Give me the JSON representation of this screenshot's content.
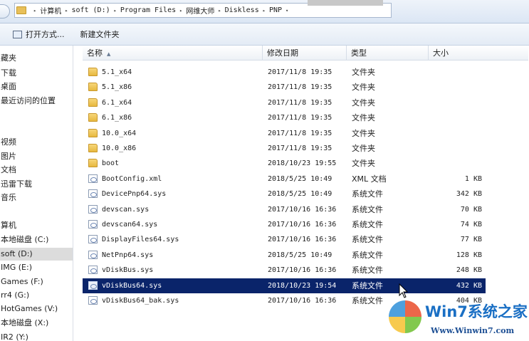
{
  "address": {
    "crumbs": [
      "计算机",
      "soft (D:)",
      "Program Files",
      "网维大师",
      "Diskless",
      "PNP"
    ]
  },
  "toolbar": {
    "open_with": "打开方式...",
    "new_folder": "新建文件夹"
  },
  "nav": {
    "items": [
      "藏夹",
      "下载",
      "桌面",
      "最近访问的位置",
      "视频",
      "图片",
      "文档",
      "迅雷下载",
      "音乐",
      "算机",
      "本地磁盘 (C:)",
      "soft (D:)",
      "IMG (E:)",
      "Games (F:)",
      "rr4 (G:)",
      "HotGames (V:)",
      "本地磁盘 (X:)",
      "IR2 (Y:)"
    ],
    "selected": "soft (D:)"
  },
  "columns": {
    "name": "名称",
    "date": "修改日期",
    "type": "类型",
    "size": "大小"
  },
  "files": [
    {
      "name": "5.1_x64",
      "date": "2017/11/8 19:35",
      "type": "文件夹",
      "size": "",
      "kind": "folder"
    },
    {
      "name": "5.1_x86",
      "date": "2017/11/8 19:35",
      "type": "文件夹",
      "size": "",
      "kind": "folder"
    },
    {
      "name": "6.1_x64",
      "date": "2017/11/8 19:35",
      "type": "文件夹",
      "size": "",
      "kind": "folder"
    },
    {
      "name": "6.1_x86",
      "date": "2017/11/8 19:35",
      "type": "文件夹",
      "size": "",
      "kind": "folder"
    },
    {
      "name": "10.0_x64",
      "date": "2017/11/8 19:35",
      "type": "文件夹",
      "size": "",
      "kind": "folder"
    },
    {
      "name": "10.0_x86",
      "date": "2017/11/8 19:35",
      "type": "文件夹",
      "size": "",
      "kind": "folder"
    },
    {
      "name": "boot",
      "date": "2018/10/23 19:55",
      "type": "文件夹",
      "size": "",
      "kind": "folder"
    },
    {
      "name": "BootConfig.xml",
      "date": "2018/5/25 10:49",
      "type": "XML 文档",
      "size": "1 KB",
      "kind": "file"
    },
    {
      "name": "DevicePnp64.sys",
      "date": "2018/5/25 10:49",
      "type": "系统文件",
      "size": "342 KB",
      "kind": "file"
    },
    {
      "name": "devscan.sys",
      "date": "2017/10/16 16:36",
      "type": "系统文件",
      "size": "70 KB",
      "kind": "file"
    },
    {
      "name": "devscan64.sys",
      "date": "2017/10/16 16:36",
      "type": "系统文件",
      "size": "74 KB",
      "kind": "file"
    },
    {
      "name": "DisplayFiles64.sys",
      "date": "2017/10/16 16:36",
      "type": "系统文件",
      "size": "77 KB",
      "kind": "file"
    },
    {
      "name": "NetPnp64.sys",
      "date": "2018/5/25 10:49",
      "type": "系统文件",
      "size": "128 KB",
      "kind": "file"
    },
    {
      "name": "vDiskBus.sys",
      "date": "2017/10/16 16:36",
      "type": "系统文件",
      "size": "248 KB",
      "kind": "file"
    },
    {
      "name": "vDiskBus64.sys",
      "date": "2018/10/23 19:54",
      "type": "系统文件",
      "size": "432 KB",
      "kind": "file"
    },
    {
      "name": "vDiskBus64_bak.sys",
      "date": "2017/10/16 16:36",
      "type": "系统文件",
      "size": "404 KB",
      "kind": "file"
    }
  ],
  "selected_file": "vDiskBus64.sys",
  "watermark": {
    "title": "Win7系统之家",
    "url": "Www.Winwin7.com"
  },
  "colors": {
    "selection": "#0a246a",
    "folder": "#e7b83f",
    "watermark_blue": "#1a6fc4"
  }
}
